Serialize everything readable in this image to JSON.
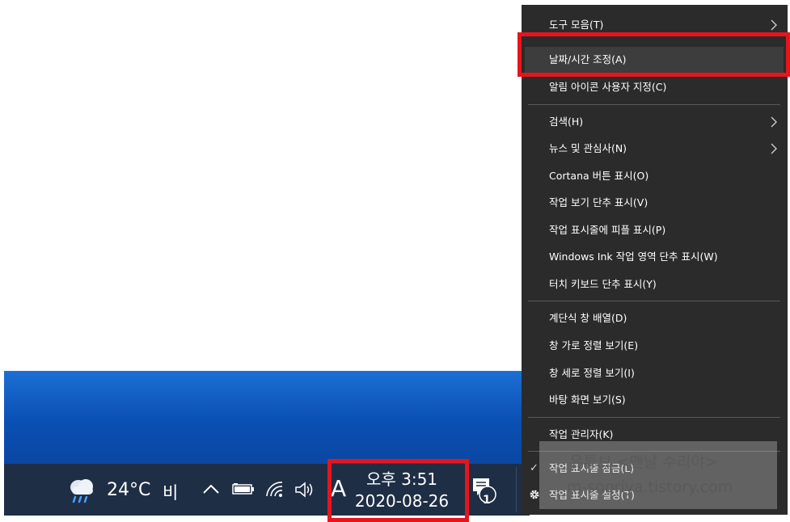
{
  "taskbar": {
    "temperature": "24°C",
    "weather_desc": "비",
    "ime_indicator": "A",
    "time": "오후 3:51",
    "date": "2020-08-26",
    "notification_count": "1"
  },
  "menu": {
    "items": [
      {
        "label": "도구 모음(T)",
        "submenu": true
      },
      {
        "label": "날짜/시간 조정(A)"
      },
      {
        "label": "알림 아이콘 사용자 지정(C)"
      },
      {
        "label": "검색(H)",
        "submenu": true
      },
      {
        "label": "뉴스 및 관심사(N)",
        "submenu": true
      },
      {
        "label": "Cortana 버튼 표시(O)"
      },
      {
        "label": "작업 보기 단추 표시(V)"
      },
      {
        "label": "작업 표시줄에 피플 표시(P)"
      },
      {
        "label": "Windows Ink 작업 영역 단추 표시(W)"
      },
      {
        "label": "터치 키보드 단추 표시(Y)"
      },
      {
        "label": "계단식 창 배열(D)"
      },
      {
        "label": "창 가로 정렬 보기(E)"
      },
      {
        "label": "창 세로 정렬 보기(I)"
      },
      {
        "label": "바탕 화면 보기(S)"
      },
      {
        "label": "작업 관리자(K)"
      },
      {
        "label": "작업 표시줄 잠금(L)",
        "checked": true
      },
      {
        "label": "작업 표시줄 설정(T)"
      }
    ]
  },
  "watermark": {
    "line1": "유튜브 <맨날 수리야>",
    "line2": "m-sooriya.tistory.com"
  },
  "colors": {
    "highlight": "#e8141c",
    "menu_bg": "#2b2b2b",
    "taskbar_bg": "#1e2e45",
    "desktop_blue": "#0a4fb3"
  }
}
